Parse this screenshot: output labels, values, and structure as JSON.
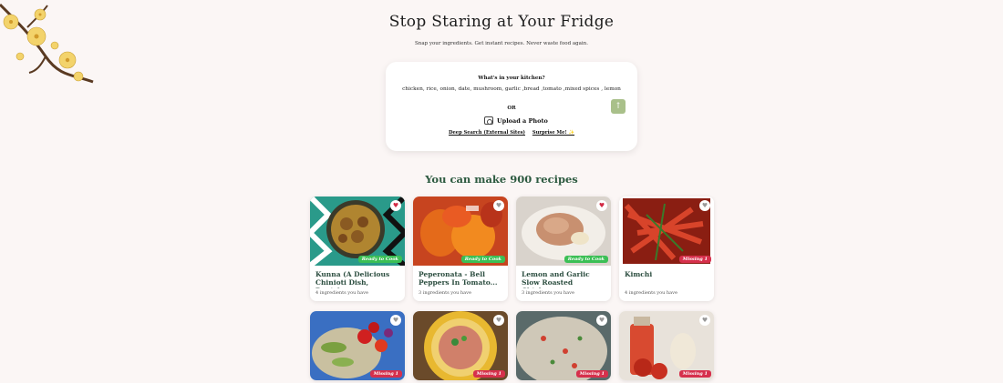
{
  "header": {
    "title": "Stop Staring at Your Fridge",
    "subtitle": "Snap your ingredients. Get instant recipes. Never waste food again."
  },
  "search": {
    "label": "What's in your kitchen?",
    "ingredients": "chicken, rice, onion, date, mushroom, garlic ,bread ,tomato ,mixed spices , lemon",
    "or": "OR",
    "upload_label": "Upload a Photo",
    "deep_search_label": "Deep Search (External Sites)",
    "surprise_label": "Surprise Me! ✨",
    "send_icon": "arrow-up-icon"
  },
  "results": {
    "count_title": "You can make 900 recipes"
  },
  "recipes": [
    {
      "name": "Kunna (A Delicious Chinioti Dish, Punjab,...",
      "have": "4 ingredients you have",
      "badge": "Ready to Cook",
      "status": "ready",
      "fav": true
    },
    {
      "name": "Peperonata - Bell Peppers In Tomato...",
      "have": "3 ingredients you have",
      "badge": "Ready to Cook",
      "status": "ready",
      "fav": false
    },
    {
      "name": "Lemon and Garlic Slow Roasted Chicken",
      "have": "3 ingredients you have",
      "badge": "Ready to Cook",
      "status": "ready",
      "fav": true
    },
    {
      "name": "Kimchi",
      "have": "4 ingredients you have",
      "badge": "Missing 1",
      "status": "missing",
      "fav": false
    },
    {
      "name": "",
      "have": "",
      "badge": "Missing 1",
      "status": "missing",
      "fav": false
    },
    {
      "name": "",
      "have": "",
      "badge": "Missing 1",
      "status": "missing",
      "fav": false
    },
    {
      "name": "",
      "have": "",
      "badge": "Missing 1",
      "status": "missing",
      "fav": false
    },
    {
      "name": "",
      "have": "",
      "badge": "Missing 1",
      "status": "missing",
      "fav": false
    }
  ],
  "colors": {
    "accent_green": "#2d5a40",
    "ready_badge": "#3bbf55",
    "missing_badge": "#d6304c",
    "send_button": "#a9c08a"
  }
}
